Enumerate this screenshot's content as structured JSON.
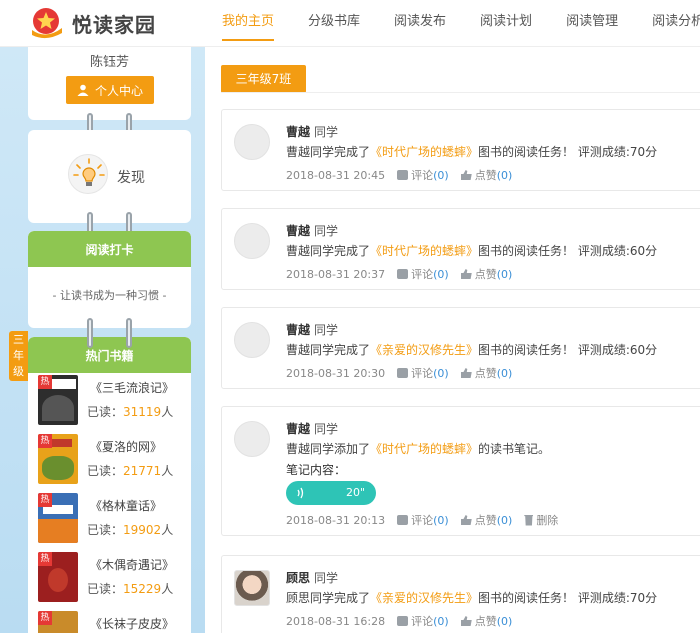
{
  "logo": {
    "text": "悦读家园"
  },
  "nav": [
    {
      "label": "我的主页",
      "active": true
    },
    {
      "label": "分级书库"
    },
    {
      "label": "阅读发布"
    },
    {
      "label": "阅读计划"
    },
    {
      "label": "阅读管理"
    },
    {
      "label": "阅读分析"
    }
  ],
  "sidebar": {
    "user_name": "陈钰芳",
    "center_button": "个人中心",
    "discover": "发现",
    "checkin_title": "阅读打卡",
    "checkin_slogan": "- 让读书成为一种习惯 -",
    "hot_title": "热门书籍",
    "grade_tab": "三年级",
    "hot_tag": "热",
    "read_prefix": "已读：",
    "read_suffix": "人",
    "books": [
      {
        "title": "《三毛流浪记》",
        "count": "31119",
        "color": "#2d2d2d"
      },
      {
        "title": "《夏洛的网》",
        "count": "21771",
        "color": "#e8a21a"
      },
      {
        "title": "《格林童话》",
        "count": "19902",
        "color": "#3a6fb5"
      },
      {
        "title": "《木偶奇遇记》",
        "count": "15229",
        "color": "#9c1f1f"
      },
      {
        "title": "《长袜子皮皮》",
        "count": "",
        "color": "#c98b2a"
      }
    ]
  },
  "main": {
    "class_tab": "三年级7班",
    "feeds": [
      {
        "name": "曹越",
        "role": "同学",
        "pre": "曹越同学完成了",
        "book": "《时代广场的蟋蟀》",
        "post": "图书的阅读任务！ 评测成绩:70分",
        "time": "2018-08-31 20:45",
        "comment_label": "评论",
        "comment_count": "(0)",
        "like_label": "点赞",
        "like_count": "(0)"
      },
      {
        "name": "曹越",
        "role": "同学",
        "pre": "曹越同学完成了",
        "book": "《时代广场的蟋蟀》",
        "post": "图书的阅读任务！ 评测成绩:60分",
        "time": "2018-08-31 20:37",
        "comment_label": "评论",
        "comment_count": "(0)",
        "like_label": "点赞",
        "like_count": "(0)"
      },
      {
        "name": "曹越",
        "role": "同学",
        "pre": "曹越同学完成了",
        "book": "《亲爱的汉修先生》",
        "post": "图书的阅读任务！ 评测成绩:60分",
        "time": "2018-08-31 20:30",
        "comment_label": "评论",
        "comment_count": "(0)",
        "like_label": "点赞",
        "like_count": "(0)"
      },
      {
        "name": "曹越",
        "role": "同学",
        "pre": "曹越同学添加了",
        "book": "《时代广场的蟋蟀》",
        "post": "的读书笔记。",
        "note_label": "笔记内容：",
        "audio_duration": "20\"",
        "time": "2018-08-31 20:13",
        "comment_label": "评论",
        "comment_count": "(0)",
        "like_label": "点赞",
        "like_count": "(0)",
        "delete_label": "删除"
      },
      {
        "name": "顾思",
        "role": "同学",
        "pre": "顾思同学完成了",
        "book": "《亲爱的汉修先生》",
        "post": "图书的阅读任务！ 评测成绩:70分",
        "time": "2018-08-31 16:28",
        "comment_label": "评论",
        "comment_count": "(0)",
        "like_label": "点赞",
        "like_count": "(0)"
      }
    ]
  },
  "colors": {
    "accent": "#f39c12",
    "green": "#8ec651",
    "link_blue": "#3b8fd6",
    "audio": "#2ec4b6"
  }
}
